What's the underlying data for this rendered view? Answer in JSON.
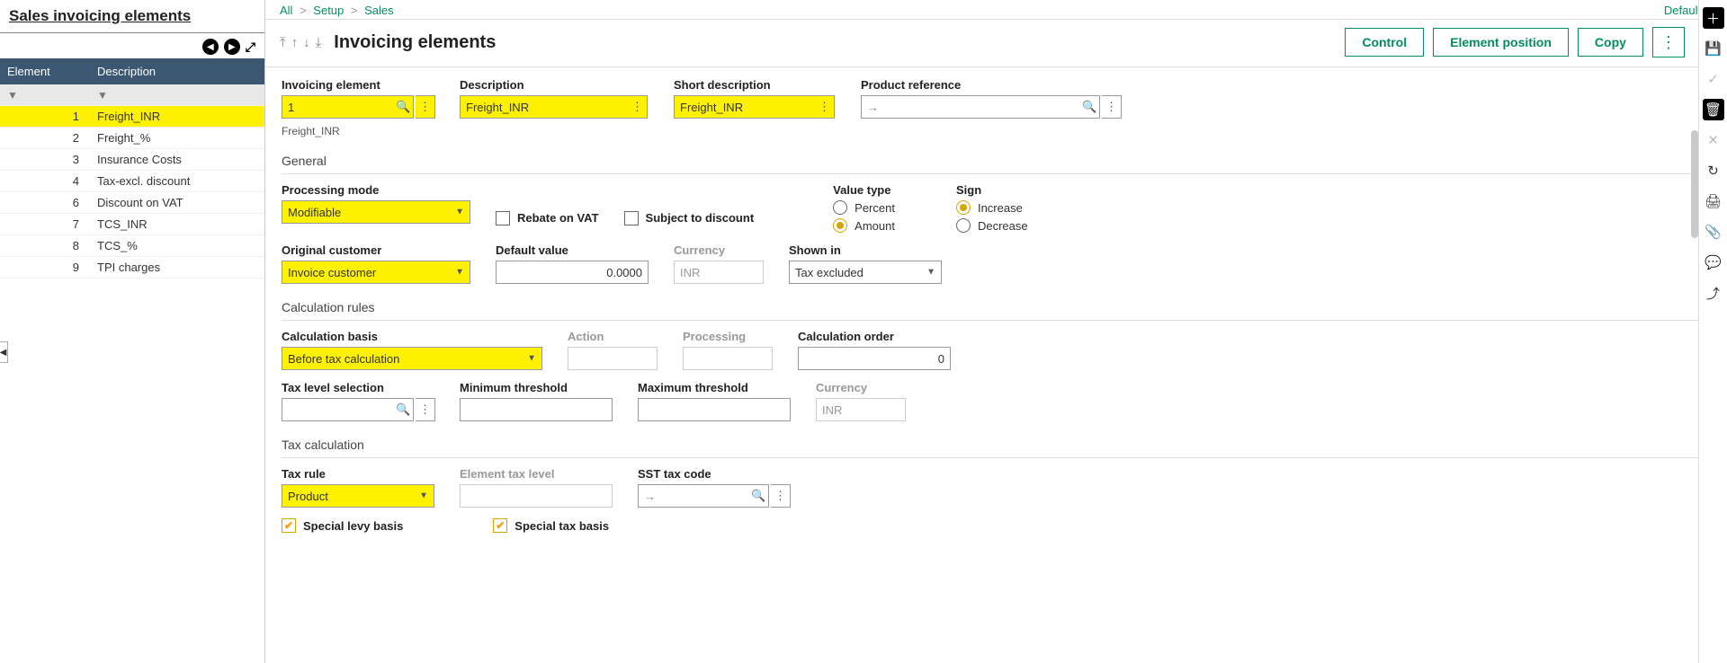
{
  "sidebar": {
    "title": "Sales invoicing elements",
    "headers": {
      "element": "Element",
      "description": "Description"
    },
    "rows": [
      {
        "num": "1",
        "desc": "Freight_INR",
        "selected": true
      },
      {
        "num": "2",
        "desc": "Freight_%"
      },
      {
        "num": "3",
        "desc": "Insurance Costs"
      },
      {
        "num": "4",
        "desc": "Tax-excl. discount"
      },
      {
        "num": "6",
        "desc": "Discount on VAT"
      },
      {
        "num": "7",
        "desc": "TCS_INR"
      },
      {
        "num": "8",
        "desc": "TCS_%"
      },
      {
        "num": "9",
        "desc": "TPI charges"
      }
    ]
  },
  "breadcrumb": {
    "all": "All",
    "setup": "Setup",
    "sales": "Sales"
  },
  "default_menu": "Default",
  "page": {
    "title": "Invoicing elements"
  },
  "actions": {
    "control": "Control",
    "position": "Element position",
    "copy": "Copy"
  },
  "header_fields": {
    "label_invoicing_element": "Invoicing element",
    "invoicing_element": "1",
    "element_hint": "Freight_INR",
    "label_description": "Description",
    "description": "Freight_INR",
    "label_short": "Short description",
    "short_description": "Freight_INR",
    "label_product_ref": "Product reference",
    "product_ref_arrow": "→"
  },
  "general": {
    "section": "General",
    "label_processing_mode": "Processing mode",
    "processing_mode": "Modifiable",
    "rebate_vat": "Rebate on VAT",
    "subject_discount": "Subject to discount",
    "label_value_type": "Value type",
    "value_percent": "Percent",
    "value_amount": "Amount",
    "label_sign": "Sign",
    "sign_increase": "Increase",
    "sign_decrease": "Decrease",
    "label_original_customer": "Original customer",
    "original_customer": "Invoice customer",
    "label_default_value": "Default value",
    "default_value": "0.0000",
    "label_currency": "Currency",
    "currency": "INR",
    "label_shown_in": "Shown in",
    "shown_in": "Tax excluded"
  },
  "calc": {
    "section": "Calculation rules",
    "label_basis": "Calculation basis",
    "basis": "Before tax calculation",
    "label_action": "Action",
    "label_processing": "Processing",
    "label_order": "Calculation order",
    "order": "0",
    "label_tax_level_sel": "Tax level selection",
    "label_min_threshold": "Minimum threshold",
    "label_max_threshold": "Maximum threshold",
    "label_currency2": "Currency",
    "currency2": "INR"
  },
  "tax": {
    "section": "Tax calculation",
    "label_tax_rule": "Tax rule",
    "tax_rule": "Product",
    "label_element_tax_level": "Element tax level",
    "label_sst": "SST tax code",
    "sst_arrow": "→",
    "special_levy": "Special levy basis",
    "special_tax": "Special tax basis"
  }
}
